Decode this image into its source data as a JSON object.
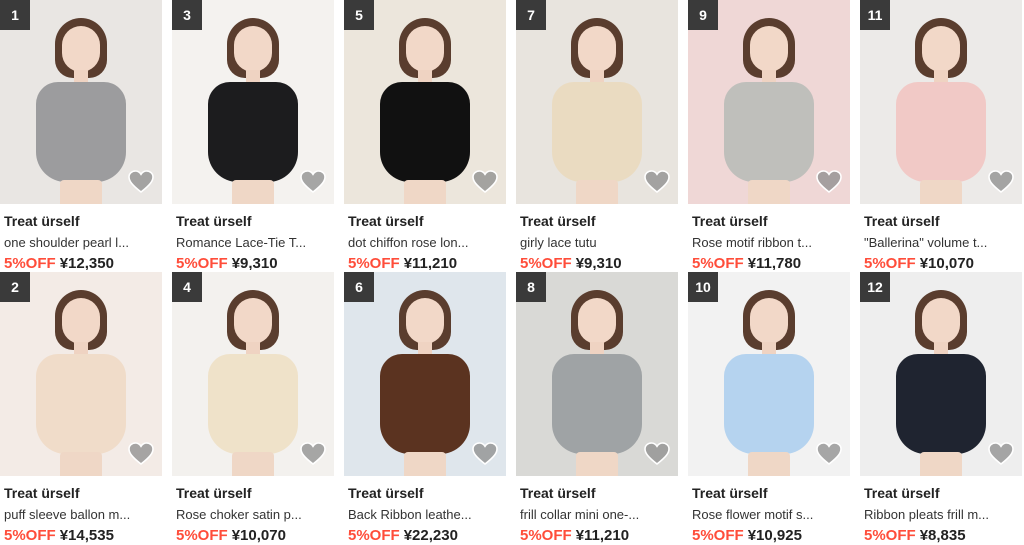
{
  "products": [
    {
      "rank": "1",
      "brand": "Treat ürself",
      "name": "one shoulder pearl l...",
      "discount": "5%OFF",
      "price": "¥12,350",
      "photo_bg": "#e9e6e3",
      "item_color": "#9c9c9e"
    },
    {
      "rank": "3",
      "brand": "Treat ürself",
      "name": "Romance Lace-Tie T...",
      "discount": "5%OFF",
      "price": "¥9,310",
      "photo_bg": "#f4f2ef",
      "item_color": "#1c1c1e"
    },
    {
      "rank": "5",
      "brand": "Treat ürself",
      "name": "dot chiffon rose lon...",
      "discount": "5%OFF",
      "price": "¥11,210",
      "photo_bg": "#ece6dc",
      "item_color": "#111111"
    },
    {
      "rank": "7",
      "brand": "Treat ürself",
      "name": "girly lace tutu",
      "discount": "5%OFF",
      "price": "¥9,310",
      "photo_bg": "#e8e4de",
      "item_color": "#eadbc1"
    },
    {
      "rank": "9",
      "brand": "Treat ürself",
      "name": "Rose motif ribbon t...",
      "discount": "5%OFF",
      "price": "¥11,780",
      "photo_bg": "#efd7d6",
      "item_color": "#bfbfbb"
    },
    {
      "rank": "11",
      "brand": "Treat ürself",
      "name": "\"Ballerina\" volume t...",
      "discount": "5%OFF",
      "price": "¥10,070",
      "photo_bg": "#eceae8",
      "item_color": "#f1c9c6"
    },
    {
      "rank": "2",
      "brand": "Treat ürself",
      "name": "puff sleeve ballon m...",
      "discount": "5%OFF",
      "price": "¥14,535",
      "photo_bg": "#f3ebe6",
      "item_color": "#f0dcc9"
    },
    {
      "rank": "4",
      "brand": "Treat ürself",
      "name": "Rose choker satin p...",
      "discount": "5%OFF",
      "price": "¥10,070",
      "photo_bg": "#f3f1ee",
      "item_color": "#efe2c9"
    },
    {
      "rank": "6",
      "brand": "Treat ürself",
      "name": "Back Ribbon leathe...",
      "discount": "5%OFF",
      "price": "¥22,230",
      "photo_bg": "#dfe6ec",
      "item_color": "#5b3320"
    },
    {
      "rank": "8",
      "brand": "Treat ürself",
      "name": "frill collar mini one-...",
      "discount": "5%OFF",
      "price": "¥11,210",
      "photo_bg": "#d9d9d6",
      "item_color": "#9fa3a5"
    },
    {
      "rank": "10",
      "brand": "Treat ürself",
      "name": "Rose flower motif s...",
      "discount": "5%OFF",
      "price": "¥10,925",
      "photo_bg": "#f2f2f2",
      "item_color": "#b5d3ef"
    },
    {
      "rank": "12",
      "brand": "Treat ürself",
      "name": "Ribbon pleats frill m...",
      "discount": "5%OFF",
      "price": "¥8,835",
      "photo_bg": "#eeeeee",
      "item_color": "#1f2430"
    }
  ],
  "colors": {
    "discount": "#ff4d3a",
    "rank_badge": "#3a3a3a",
    "heart": "#9a9a9a"
  },
  "icons": {
    "favorite": "heart-icon"
  }
}
